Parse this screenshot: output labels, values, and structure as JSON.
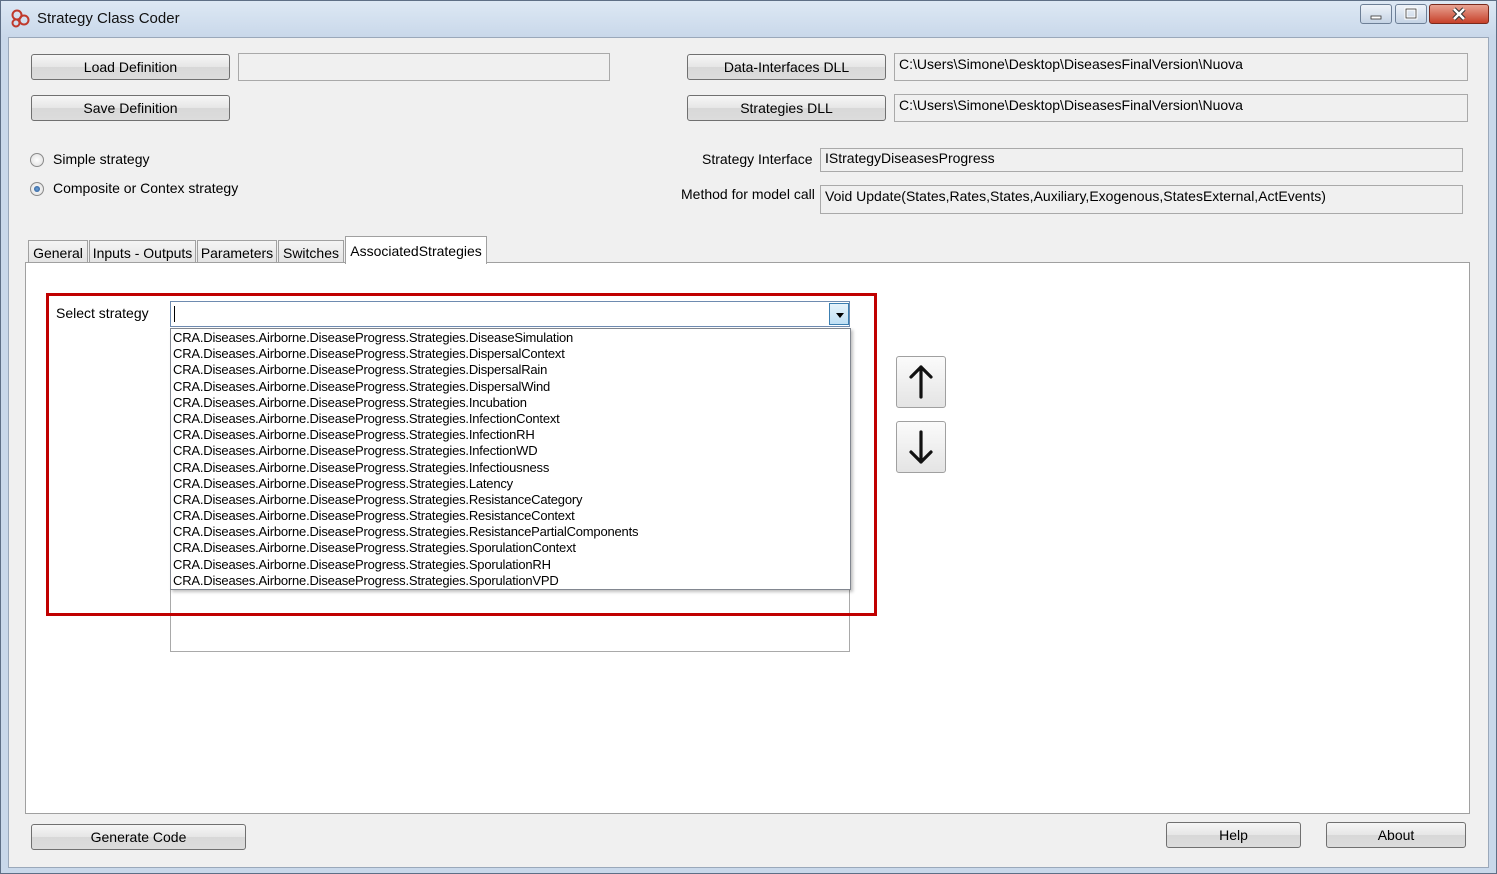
{
  "window": {
    "title": "Strategy Class Coder"
  },
  "definition": {
    "load_label": "Load Definition",
    "save_label": "Save Definition",
    "file_value": ""
  },
  "dll": {
    "data_interfaces_label": "Data-Interfaces DLL",
    "data_interfaces_path": "C:\\Users\\Simone\\Desktop\\DiseasesFinalVersion\\Nuova",
    "strategies_label": "Strategies DLL",
    "strategies_path": "C:\\Users\\Simone\\Desktop\\DiseasesFinalVersion\\Nuova"
  },
  "strategy_type": {
    "simple_label": "Simple strategy",
    "composite_label": "Composite or Contex strategy",
    "selected": "composite"
  },
  "interface": {
    "strategy_interface_label": "Strategy Interface",
    "strategy_interface_value": "IStrategyDiseasesProgress",
    "method_label": "Method for model call",
    "method_value": "Void Update(States,Rates,States,Auxiliary,Exogenous,StatesExternal,ActEvents)"
  },
  "tabs": [
    {
      "label": "General"
    },
    {
      "label": "Inputs - Outputs"
    },
    {
      "label": "Parameters"
    },
    {
      "label": "Switches"
    },
    {
      "label": "AssociatedStrategies",
      "active": true
    }
  ],
  "associated": {
    "select_label": "Select strategy",
    "combo_value": "",
    "dropdown_items": [
      "CRA.Diseases.Airborne.DiseaseProgress.Strategies.DiseaseSimulation",
      "CRA.Diseases.Airborne.DiseaseProgress.Strategies.DispersalContext",
      "CRA.Diseases.Airborne.DiseaseProgress.Strategies.DispersalRain",
      "CRA.Diseases.Airborne.DiseaseProgress.Strategies.DispersalWind",
      "CRA.Diseases.Airborne.DiseaseProgress.Strategies.Incubation",
      "CRA.Diseases.Airborne.DiseaseProgress.Strategies.InfectionContext",
      "CRA.Diseases.Airborne.DiseaseProgress.Strategies.InfectionRH",
      "CRA.Diseases.Airborne.DiseaseProgress.Strategies.InfectionWD",
      "CRA.Diseases.Airborne.DiseaseProgress.Strategies.Infectiousness",
      "CRA.Diseases.Airborne.DiseaseProgress.Strategies.Latency",
      "CRA.Diseases.Airborne.DiseaseProgress.Strategies.ResistanceCategory",
      "CRA.Diseases.Airborne.DiseaseProgress.Strategies.ResistanceContext",
      "CRA.Diseases.Airborne.DiseaseProgress.Strategies.ResistancePartialComponents",
      "CRA.Diseases.Airborne.DiseaseProgress.Strategies.SporulationContext",
      "CRA.Diseases.Airborne.DiseaseProgress.Strategies.SporulationRH",
      "CRA.Diseases.Airborne.DiseaseProgress.Strategies.SporulationVPD"
    ]
  },
  "footer": {
    "generate_label": "Generate Code",
    "help_label": "Help",
    "about_label": "About"
  },
  "icons": {
    "app": "app-logo-icon",
    "move_up": "arrow-up-icon",
    "move_down": "arrow-down-icon"
  },
  "colors": {
    "highlight": "#c00000",
    "combo_button": "#3c7fb1"
  }
}
